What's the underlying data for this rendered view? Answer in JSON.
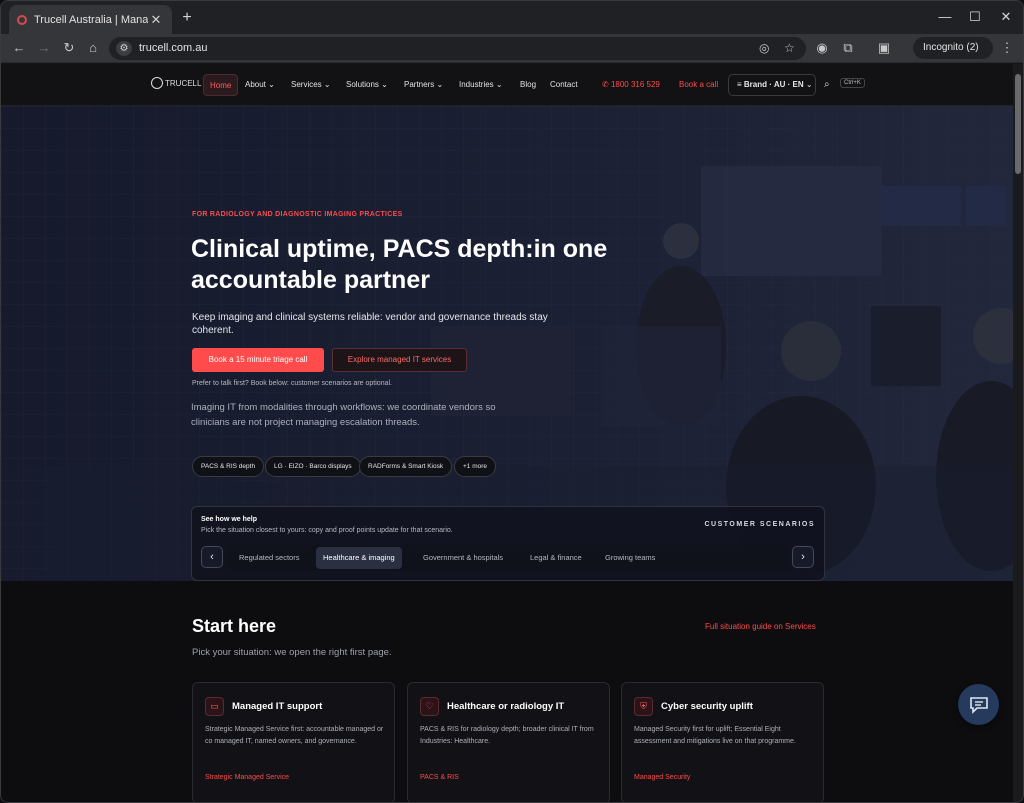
{
  "browser": {
    "tab_title": "Trucell Australia | Managed IT, c",
    "url": "trucell.com.au",
    "incognito_label": "Incognito (2)"
  },
  "nav": {
    "logo_text": "TRUCELL",
    "items": [
      "Home",
      "About",
      "Services",
      "Solutions",
      "Partners",
      "Industries",
      "Blog",
      "Contact"
    ],
    "phone": "1800 316 529",
    "book_call": "Book a call",
    "brand_selector": "Brand · AU · EN",
    "search_shortcut": "Ctrl+K"
  },
  "hero": {
    "eyebrow": "FOR RADIOLOGY AND DIAGNOSTIC IMAGING PRACTICES",
    "title": "Clinical uptime, PACS depth:in one accountable partner",
    "subtitle": "Keep imaging and clinical systems reliable: vendor and governance threads stay coherent.",
    "primary_cta": "Book a 15 minute triage call",
    "secondary_cta": "Explore managed IT services",
    "fine_print": "Prefer to talk first? Book below: customer scenarios are optional.",
    "paragraph": "Imaging IT from modalities through workflows: we coordinate vendors so clinicians are not project managing escalation threads.",
    "chips": [
      "PACS & RIS depth",
      "LG · EIZO · Barco displays",
      "RADForms & Smart Kiosk",
      "+1 more"
    ]
  },
  "scenarios": {
    "heading": "See how we help",
    "description": "Pick the situation closest to yours: copy and proof points update for that scenario.",
    "label": "CUSTOMER SCENARIOS",
    "tabs": [
      "Regulated sectors",
      "Healthcare & imaging",
      "Government & hospitals",
      "Legal & finance",
      "Growing teams"
    ],
    "active_tab": "Healthcare & imaging"
  },
  "start": {
    "title": "Start here",
    "subtitle": "Pick your situation: we open the right first page.",
    "guide_link": "Full situation guide on Services",
    "cards": [
      {
        "title": "Managed IT support",
        "desc": "Strategic Managed Service first: accountable managed or co managed IT, named owners, and governance.",
        "link": "Strategic Managed Service",
        "icon": "briefcase-icon"
      },
      {
        "title": "Healthcare or radiology IT",
        "desc": "PACS & RIS for radiology depth; broader clinical IT from Industries: Healthcare.",
        "link": "PACS & RIS",
        "icon": "monitor-heart-icon"
      },
      {
        "title": "Cyber security uplift",
        "desc": "Managed Security first for uplift; Essential Eight assessment and mitigations live on that programme.",
        "link": "Managed Security",
        "icon": "shield-icon"
      }
    ]
  },
  "colors": {
    "accent": "#ff4b4b",
    "background": "#0d0d10",
    "chat": "#253a5c"
  }
}
